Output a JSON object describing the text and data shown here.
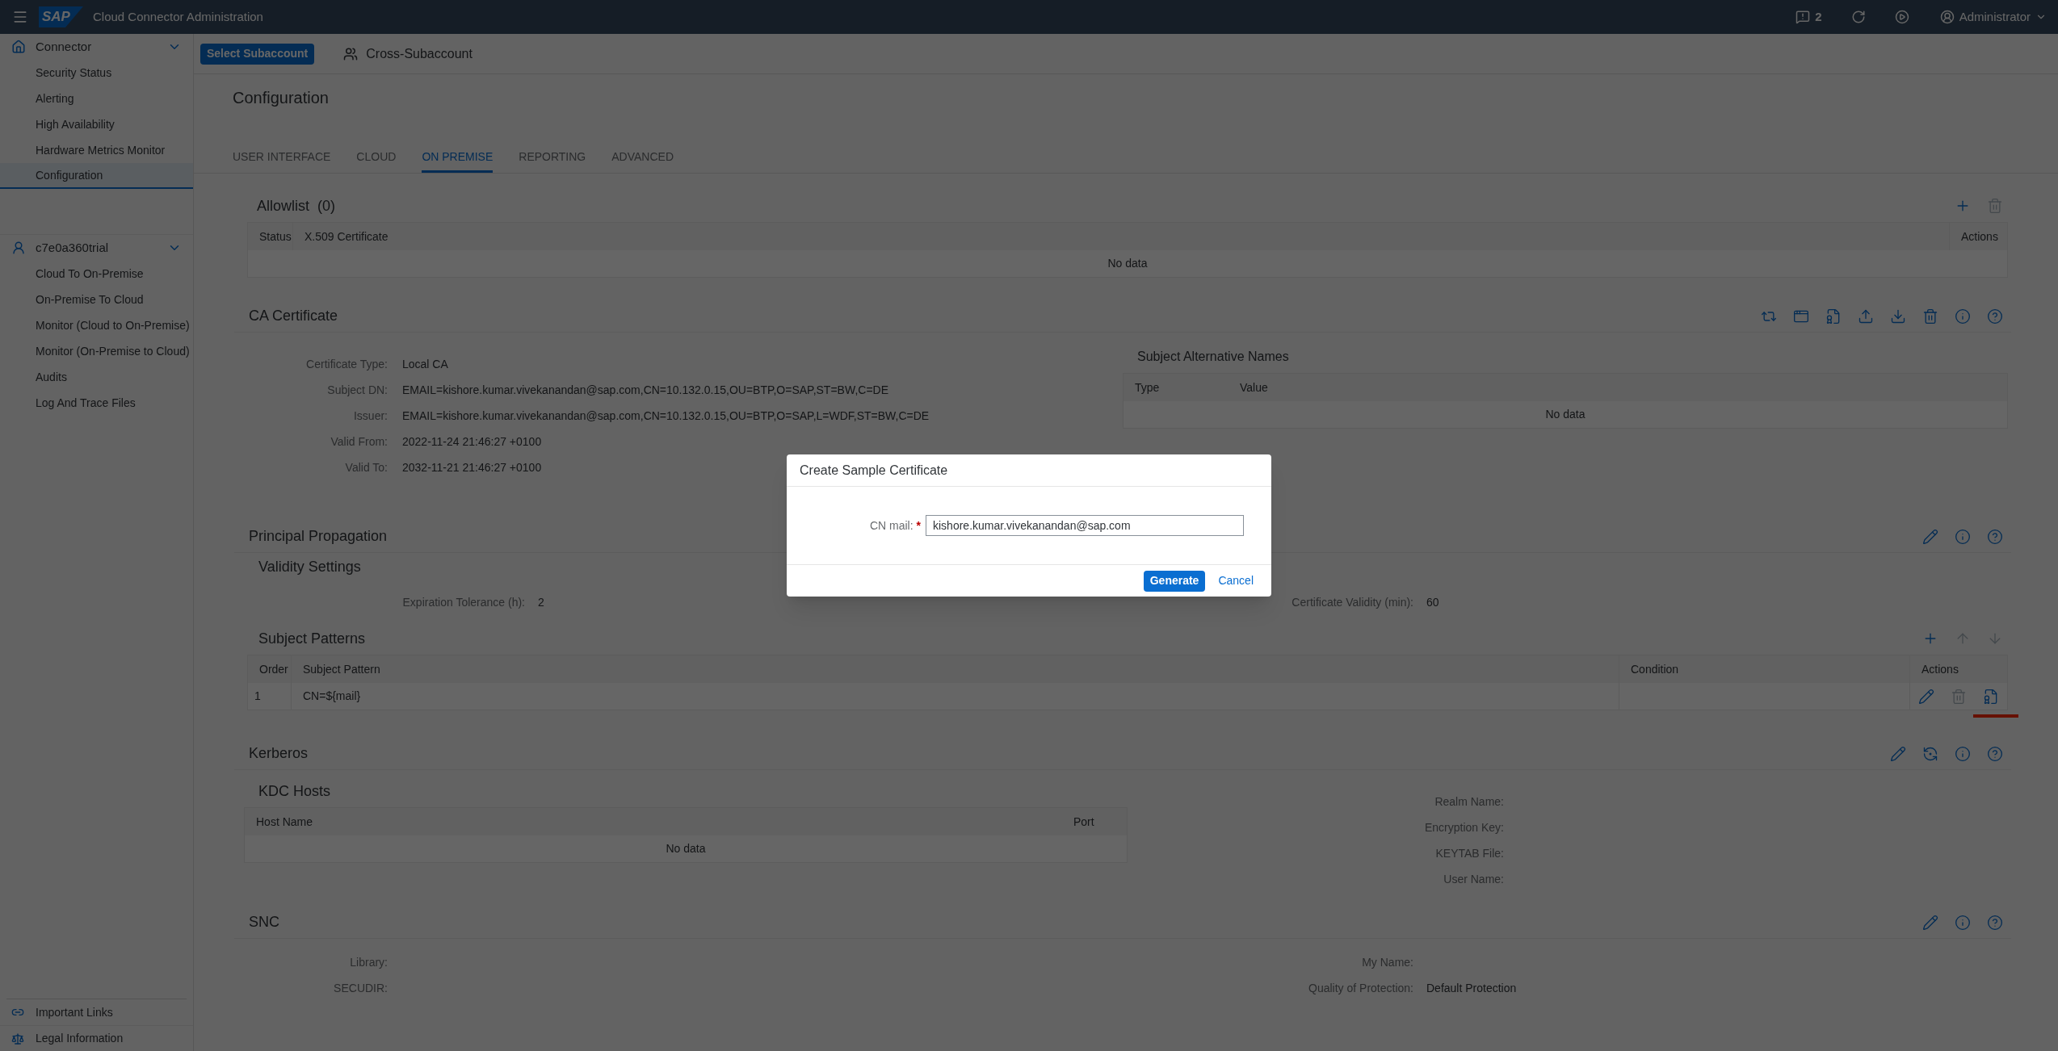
{
  "shell": {
    "logo": "SAP",
    "title": "Cloud Connector Administration",
    "notifications": "2",
    "user": "Administrator"
  },
  "sidebar": {
    "groups": [
      {
        "kind": "home",
        "label": "Connector",
        "expanded": true,
        "items": [
          {
            "label": "Security Status",
            "selected": false
          },
          {
            "label": "Alerting",
            "selected": false
          },
          {
            "label": "High Availability",
            "selected": false
          },
          {
            "label": "Hardware Metrics Monitor",
            "selected": false
          },
          {
            "label": "Configuration",
            "selected": true
          }
        ]
      },
      {
        "kind": "account",
        "label": "c7e0a360trial",
        "expanded": true,
        "items": [
          {
            "label": "Cloud To On-Premise",
            "selected": false
          },
          {
            "label": "On-Premise To Cloud",
            "selected": false
          },
          {
            "label": "Monitor (Cloud to On-Premise)",
            "selected": false
          },
          {
            "label": "Monitor (On-Premise to Cloud)",
            "selected": false
          },
          {
            "label": "Audits",
            "selected": false
          },
          {
            "label": "Log And Trace Files",
            "selected": false
          }
        ]
      }
    ],
    "footer": [
      {
        "kind": "link",
        "label": "Important Links"
      },
      {
        "kind": "legal",
        "label": "Legal Information"
      }
    ]
  },
  "subaccount_bar": {
    "button": "Select Subaccount",
    "cross": "Cross-Subaccount"
  },
  "page_title": "Configuration",
  "tabs": [
    {
      "label": "USER INTERFACE",
      "selected": false
    },
    {
      "label": "CLOUD",
      "selected": false
    },
    {
      "label": "ON PREMISE",
      "selected": true
    },
    {
      "label": "REPORTING",
      "selected": false
    },
    {
      "label": "ADVANCED",
      "selected": false
    }
  ],
  "allowlist": {
    "title": "Allowlist  (0)",
    "tools": [
      {
        "kind": "add",
        "disabled": false
      },
      {
        "kind": "delete",
        "disabled": true
      }
    ],
    "columns": [
      "Status",
      "X.509 Certificate",
      "Actions"
    ],
    "empty": "No data"
  },
  "ca_certificate": {
    "title": "CA Certificate",
    "tools": [
      {
        "kind": "sync",
        "disabled": false
      },
      {
        "kind": "window",
        "disabled": false
      },
      {
        "kind": "certificate",
        "disabled": false
      },
      {
        "kind": "upload",
        "disabled": false
      },
      {
        "kind": "download",
        "disabled": false
      },
      {
        "kind": "delete",
        "disabled": false
      },
      {
        "kind": "info",
        "disabled": false
      },
      {
        "kind": "help",
        "disabled": false
      }
    ],
    "fields": [
      {
        "label": "Certificate Type:",
        "value": "Local CA"
      },
      {
        "label": "Subject DN:",
        "value": "EMAIL=kishore.kumar.vivekanandan@sap.com,CN=10.132.0.15,OU=BTP,O=SAP,ST=BW,C=DE"
      },
      {
        "label": "Issuer:",
        "value": "EMAIL=kishore.kumar.vivekanandan@sap.com,CN=10.132.0.15,OU=BTP,O=SAP,L=WDF,ST=BW,C=DE"
      },
      {
        "label": "Valid From:",
        "value": "2022-11-24 21:46:27 +0100"
      },
      {
        "label": "Valid To:",
        "value": "2032-11-21 21:46:27 +0100"
      }
    ],
    "san": {
      "title": "Subject Alternative Names",
      "columns": [
        "Type",
        "Value"
      ],
      "empty": "No data"
    }
  },
  "principal_propagation": {
    "title": "Principal Propagation",
    "tools": [
      {
        "kind": "edit",
        "disabled": false
      },
      {
        "kind": "info",
        "disabled": false
      },
      {
        "kind": "help",
        "disabled": false
      }
    ],
    "validity_title": "Validity Settings",
    "settings": [
      {
        "label": "Expiration Tolerance (h):",
        "value": "2"
      },
      {
        "label": "Certificate Validity (min):",
        "value": "60"
      }
    ],
    "patterns": {
      "title": "Subject Patterns",
      "tools": [
        {
          "kind": "add",
          "disabled": false
        },
        {
          "kind": "up",
          "disabled": true
        },
        {
          "kind": "down",
          "disabled": true
        }
      ],
      "columns": [
        "Order",
        "Subject Pattern",
        "Condition",
        "Actions"
      ],
      "rows": [
        {
          "order": "1",
          "pattern": "CN=${mail}",
          "actions": [
            {
              "kind": "edit",
              "disabled": false
            },
            {
              "kind": "delete",
              "disabled": true
            },
            {
              "kind": "certificate",
              "disabled": false,
              "highlighted": true
            }
          ]
        }
      ]
    }
  },
  "kerberos": {
    "title": "Kerberos",
    "tools": [
      {
        "kind": "edit",
        "disabled": false
      },
      {
        "kind": "reset",
        "disabled": false
      },
      {
        "kind": "info",
        "disabled": false
      },
      {
        "kind": "help",
        "disabled": false
      }
    ],
    "kdc": {
      "title": "KDC Hosts",
      "columns": [
        "Host Name",
        "Port"
      ],
      "empty": "No data"
    },
    "fields": [
      "Realm Name:",
      "Encryption Key:",
      "KEYTAB File:",
      "User Name:"
    ]
  },
  "snc": {
    "title": "SNC",
    "tools": [
      {
        "kind": "edit",
        "disabled": false
      },
      {
        "kind": "info",
        "disabled": false
      },
      {
        "kind": "help",
        "disabled": false
      }
    ],
    "left": [
      {
        "label": "Library:"
      },
      {
        "label": "SECUDIR:"
      }
    ],
    "right": [
      {
        "label": "My Name:"
      },
      {
        "label": "Quality of Protection:",
        "value": "Default Protection"
      }
    ]
  },
  "dialog": {
    "title": "Create Sample Certificate",
    "label": "CN mail:",
    "required": true,
    "required_mark": "*",
    "value": "kishore.kumar.vivekanandan@sap.com",
    "primary": "Generate",
    "cancel": "Cancel"
  }
}
